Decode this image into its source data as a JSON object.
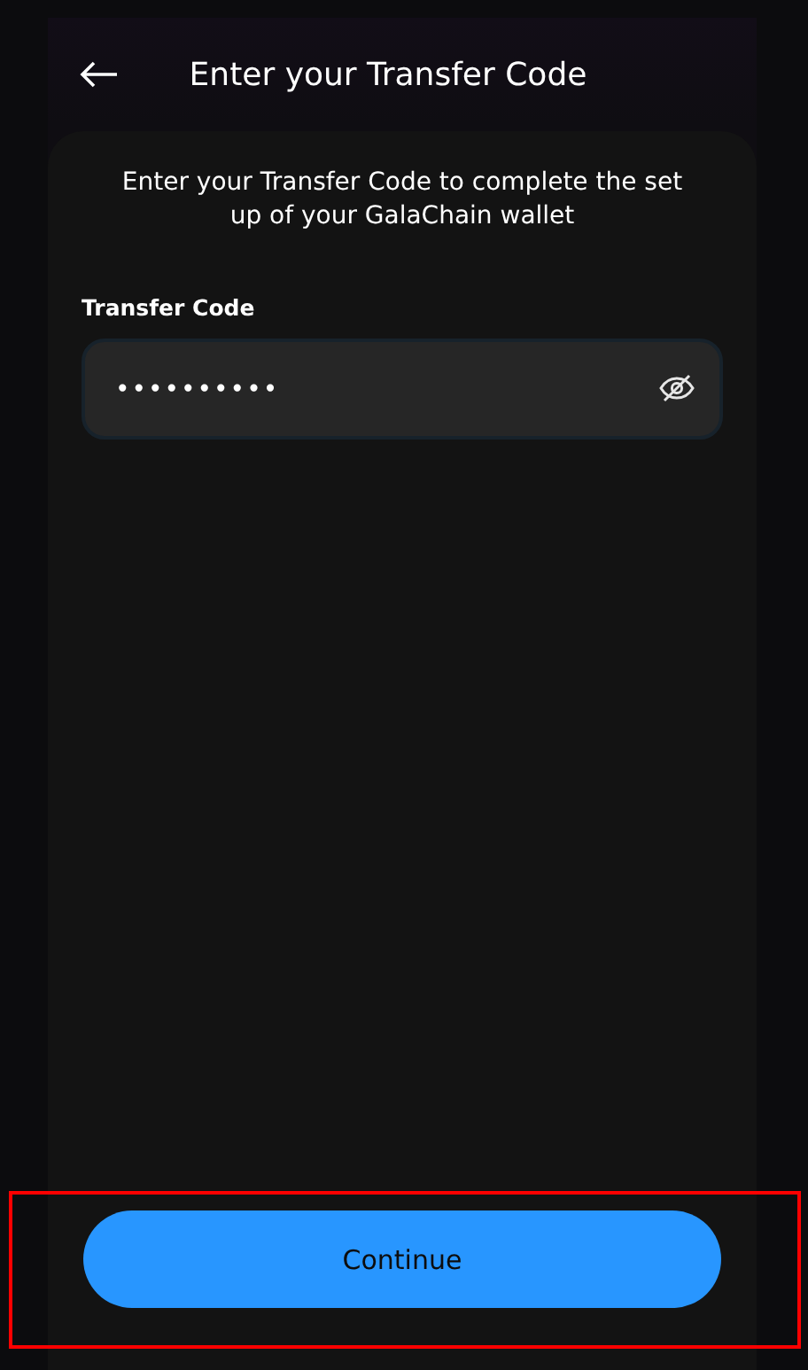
{
  "header": {
    "title": "Enter your Transfer Code"
  },
  "instructions": "Enter your Transfer Code to complete the set up of your GalaChain wallet",
  "transfer_code": {
    "label": "Transfer Code",
    "value": "••••••••••",
    "masked": true
  },
  "continue_button": {
    "label": "Continue",
    "highlighted": true
  }
}
